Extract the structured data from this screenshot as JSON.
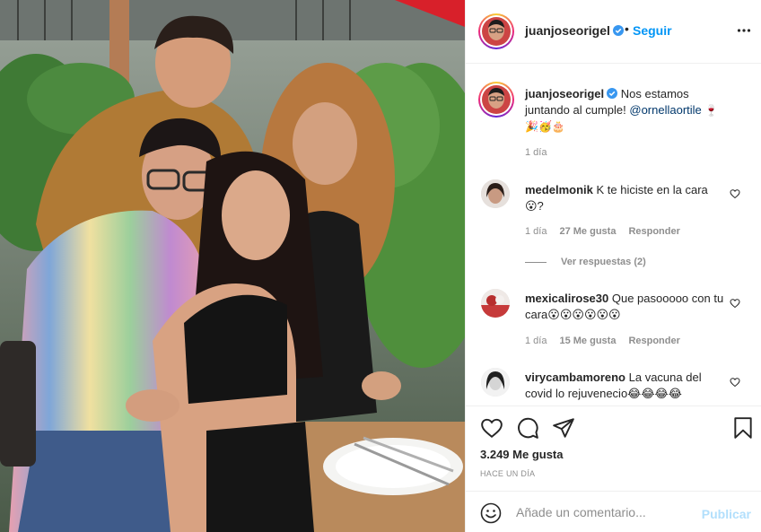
{
  "post": {
    "username": "juanjoseorigel",
    "separator": "•",
    "follow_label": "Seguir",
    "more_icon": "more-horizontal-icon",
    "verified_icon": "verified-badge-icon"
  },
  "caption": {
    "username": "juanjoseorigel",
    "text": "Nos estamos juntando al cumple!",
    "mention": "@ornellaortile",
    "emojis_line1": "🍷",
    "emojis_line2": "🎉🥳🎂",
    "time": "1 día"
  },
  "comments": [
    {
      "username": "medelmonik",
      "text": "K te hiciste en la cara😮?",
      "time": "1 día",
      "likes": "27 Me gusta",
      "reply": "Responder",
      "view_replies": "Ver respuestas (2)"
    },
    {
      "username": "mexicalirose30",
      "text": "Que pasooooo con tu cara😮😮😮😮😮😮",
      "time": "1 día",
      "likes": "15 Me gusta",
      "reply": "Responder"
    },
    {
      "username": "virycambamoreno",
      "text": "La vacuna del covid lo rejuvenecio😂😂😂😂"
    }
  ],
  "actions": {
    "like_icon": "heart-icon",
    "comment_icon": "comment-icon",
    "share_icon": "share-icon",
    "save_icon": "bookmark-icon",
    "likes": "3.249 Me gusta",
    "posted_ago": "HACE UN DÍA"
  },
  "add_comment": {
    "placeholder": "Añade un comentario...",
    "publish_label": "Publicar",
    "emoji_icon": "emoji-icon"
  },
  "colors": {
    "link": "#0095f6",
    "mention": "#00376b",
    "muted": "#8e8e8e",
    "publish_disabled": "#b2dffc"
  }
}
